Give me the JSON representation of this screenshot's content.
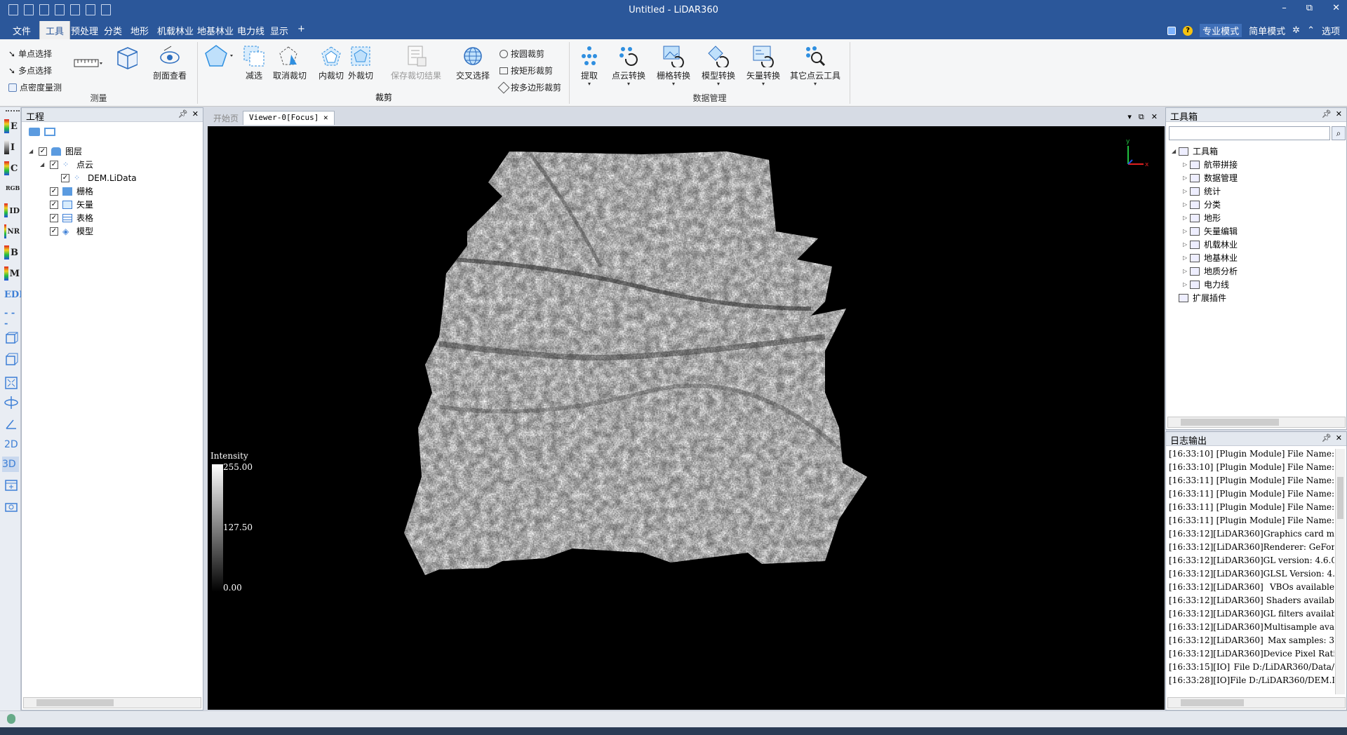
{
  "window": {
    "title": "Untitled - LiDAR360",
    "controls": [
      "–",
      "⧉",
      "✕"
    ]
  },
  "menu": {
    "tabs": [
      "文件",
      "工具",
      "预处理",
      "分类",
      "地形",
      "机载林业",
      "地基林业",
      "电力线",
      "显示",
      "+"
    ],
    "active_index": 1,
    "right": {
      "pro_mode": "专业模式",
      "simple_mode": "简单模式",
      "options": "选项"
    }
  },
  "ribbon": {
    "measure": {
      "label": "测量",
      "single_select": "单点选择",
      "multi_select": "多点选择",
      "density": "点密度量测",
      "profile": "剖面查看"
    },
    "clip": {
      "label": "裁剪",
      "subtract": "减选",
      "cancel_clip": "取消裁切",
      "inner_clip": "内裁切",
      "outer_clip": "外裁切",
      "save_clip": "保存裁切结果",
      "cross_select": "交叉选择",
      "circle_clip": "按圆裁剪",
      "rect_clip": "按矩形裁剪",
      "poly_clip": "按多边形裁剪"
    },
    "data": {
      "label": "数据管理",
      "extract": "提取",
      "pc_convert": "点云转换",
      "raster_convert": "栅格转换",
      "model_convert": "模型转换",
      "vector_convert": "矢量转换",
      "other_tools": "其它点云工具"
    }
  },
  "left_toolbar": [
    "E",
    "I",
    "C",
    "RGB",
    "ID",
    "NR",
    "B",
    "M",
    "EDL",
    "2D",
    "3D"
  ],
  "project": {
    "title": "工程",
    "tree": [
      {
        "label": "图层",
        "level": 0,
        "checked": true,
        "expanded": true
      },
      {
        "label": "点云",
        "level": 1,
        "checked": true,
        "expanded": true
      },
      {
        "label": "DEM.LiData",
        "level": 2,
        "checked": true
      },
      {
        "label": "栅格",
        "level": 1,
        "checked": true
      },
      {
        "label": "矢量",
        "level": 1,
        "checked": true
      },
      {
        "label": "表格",
        "level": 1,
        "checked": true
      },
      {
        "label": "模型",
        "level": 1,
        "checked": true
      }
    ]
  },
  "viewer": {
    "tabs": [
      "开始页",
      "Viewer-0[Focus]"
    ],
    "legend": {
      "title": "Intensity",
      "max": "255.00",
      "mid": "127.50",
      "min": "0.00"
    },
    "axis": {
      "x": "x",
      "y": "y"
    }
  },
  "toolbox": {
    "title": "工具箱",
    "root": "工具箱",
    "items": [
      "航带拼接",
      "数据管理",
      "统计",
      "分类",
      "地形",
      "矢量编辑",
      "机载林业",
      "地基林业",
      "地质分析",
      "电力线"
    ],
    "plugins": "扩展插件"
  },
  "log": {
    "title": "日志输出",
    "rows": [
      {
        "t": "[16:33:10]",
        "src": "[Plugin Module]",
        "msg": "File Name:"
      },
      {
        "t": "[16:33:10]",
        "src": "[Plugin Module]",
        "msg": "File Name:"
      },
      {
        "t": "[16:33:11]",
        "src": "[Plugin Module]",
        "msg": "File Name:"
      },
      {
        "t": "[16:33:11]",
        "src": "[Plugin Module]",
        "msg": "File Name:"
      },
      {
        "t": "[16:33:11]",
        "src": "[Plugin Module]",
        "msg": "File Name:"
      },
      {
        "t": "[16:33:11]",
        "src": "[Plugin Module]",
        "msg": "File Name:"
      },
      {
        "t": "[16:33:12]",
        "src": "[LiDAR360]",
        "msg": "Graphics card m"
      },
      {
        "t": "[16:33:12]",
        "src": "[LiDAR360]",
        "msg": "Renderer: GeFor"
      },
      {
        "t": "[16:33:12]",
        "src": "[LiDAR360]",
        "msg": "GL version: 4.6.0"
      },
      {
        "t": "[16:33:12]",
        "src": "[LiDAR360]",
        "msg": "GLSL Version: 4."
      },
      {
        "t": "[16:33:12]",
        "src": "[LiDAR360]",
        "msg": "VBOs available"
      },
      {
        "t": "[16:33:12]",
        "src": "[LiDAR360]",
        "msg": "Shaders availab"
      },
      {
        "t": "[16:33:12]",
        "src": "[LiDAR360]",
        "msg": "GL filters availab"
      },
      {
        "t": "[16:33:12]",
        "src": "[LiDAR360]",
        "msg": "Multisample ava"
      },
      {
        "t": "[16:33:12]",
        "src": "[LiDAR360]",
        "msg": "Max samples: 3"
      },
      {
        "t": "[16:33:12]",
        "src": "[LiDAR360]",
        "msg": "Device Pixel Rati"
      },
      {
        "t": "[16:33:15]",
        "src": "[IO]",
        "msg": "File D:/LiDAR360/Data/"
      },
      {
        "t": "[16:33:28]",
        "src": "[IO]",
        "msg": "File D:/LiDAR360/DEM.L"
      }
    ]
  }
}
